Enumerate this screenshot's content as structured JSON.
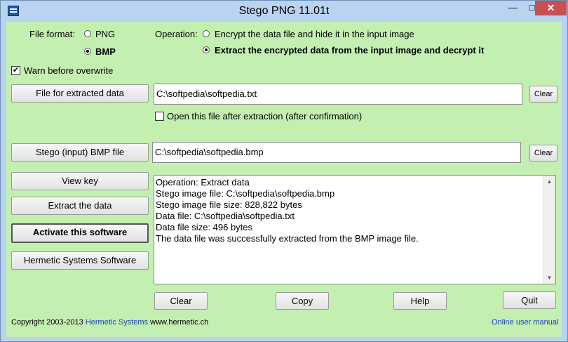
{
  "window": {
    "title": "Stego PNG 11.01t",
    "minimize_glyph": "—",
    "maximize_glyph": "□",
    "close_glyph": "✕"
  },
  "format": {
    "label": "File format:",
    "options": [
      {
        "label": "PNG",
        "selected": false
      },
      {
        "label": "BMP",
        "selected": true
      }
    ]
  },
  "operation": {
    "label": "Operation:",
    "options": [
      {
        "label": "Encrypt the data file and hide it in the input image",
        "selected": false
      },
      {
        "label": "Extract the encrypted data from the input image and decrypt it",
        "selected": true
      }
    ]
  },
  "warn_overwrite": {
    "label": "Warn before overwrite",
    "checked": true,
    "check_glyph": "✔"
  },
  "extracted": {
    "button_label": "File for extracted data",
    "value": "C:\\softpedia\\softpedia.txt",
    "clear_label": "Clear",
    "open_after": {
      "label": "Open this file after extraction (after confirmation)",
      "checked": false
    }
  },
  "stego": {
    "button_label": "Stego (input) BMP file",
    "value": "C:\\softpedia\\softpedia.bmp",
    "clear_label": "Clear"
  },
  "side_buttons": {
    "view_key": "View key",
    "extract": "Extract the data",
    "activate": "Activate this software",
    "hermetic": "Hermetic Systems Software"
  },
  "log": {
    "lines": [
      "Operation: Extract data",
      "Stego image file: C:\\softpedia\\softpedia.bmp",
      "Stego image file size: 828,822 bytes",
      "Data file: C:\\softpedia\\softpedia.txt",
      "Data file size: 496 bytes",
      "The data file was successfully extracted from the BMP image file."
    ],
    "scroll_up": "▲",
    "scroll_down": "▼"
  },
  "bottom_buttons": {
    "clear": "Clear",
    "copy": "Copy",
    "help": "Help",
    "quit": "Quit"
  },
  "footer": {
    "copyright": "Copyright 2003-2013",
    "company": "Hermetic Systems",
    "website": "www.hermetic.ch",
    "manual": "Online user manual"
  },
  "colors": {
    "client_background": "#c3efb1",
    "titlebar": "#b9d3f0",
    "close_button": "#c75050",
    "link": "#1a3db5"
  }
}
